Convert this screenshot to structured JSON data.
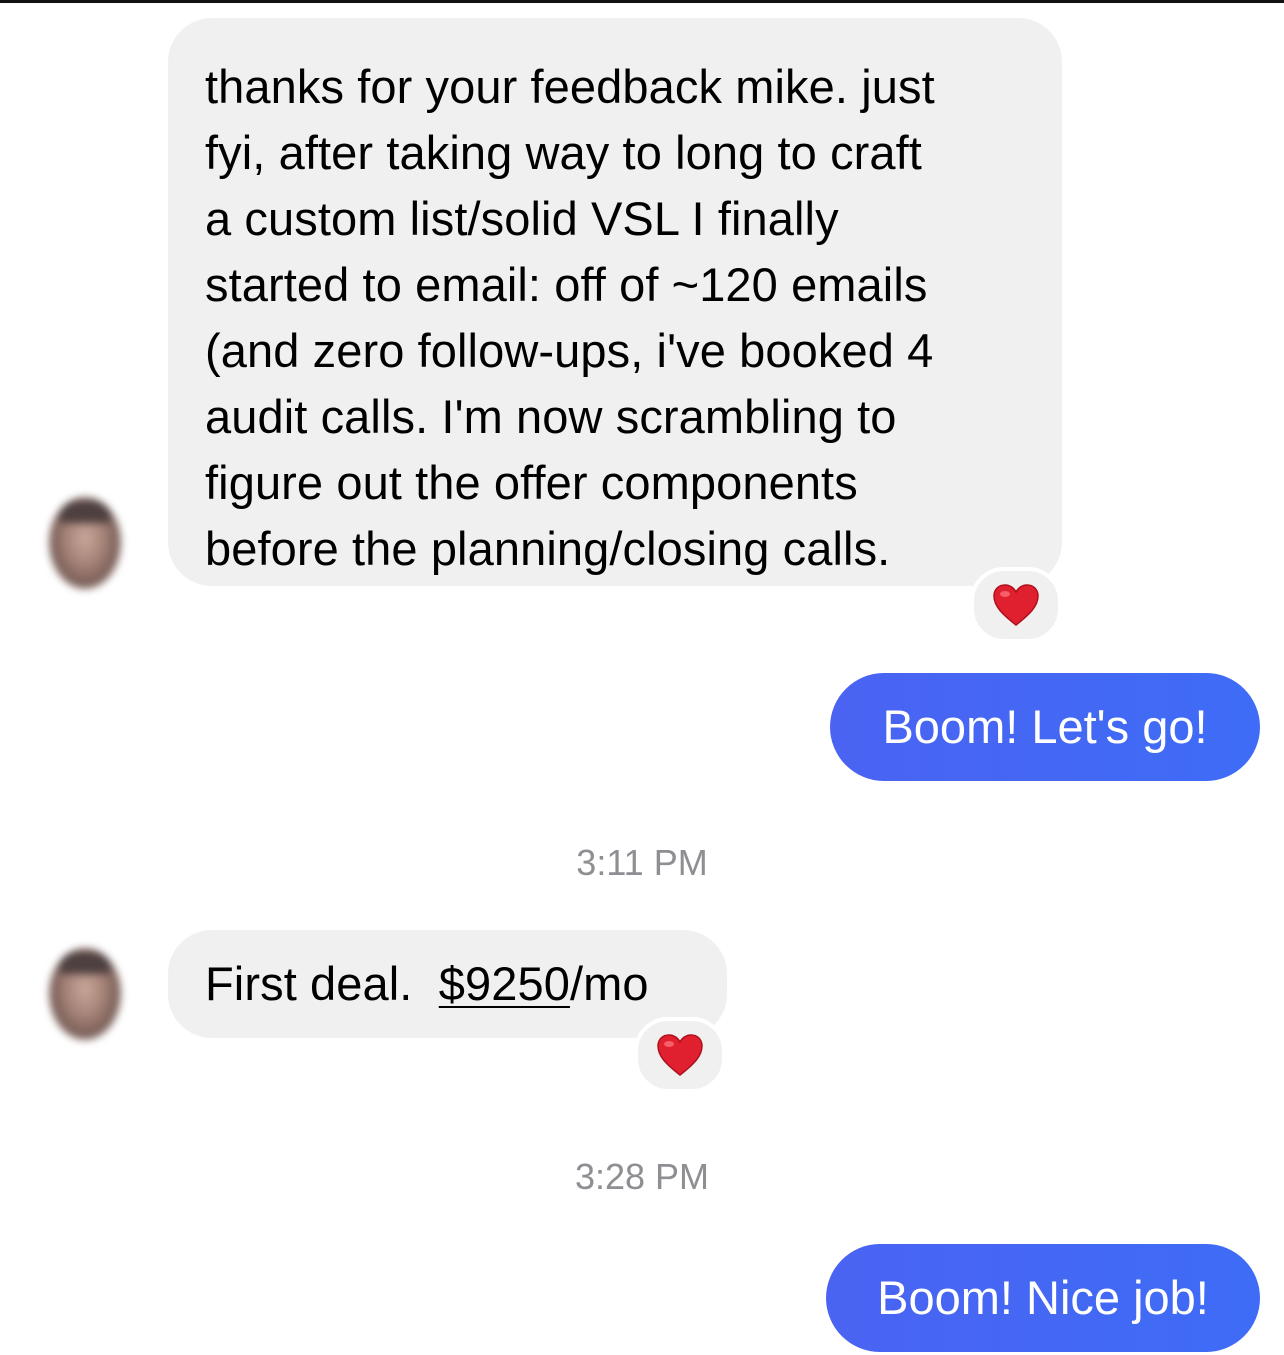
{
  "messages": [
    {
      "type": "incoming",
      "lines": [
        "thanks for your feedback mike.  just",
        "fyi, after taking way to long to craft",
        "a custom list/solid VSL I finally",
        "started to email: off of ~120 emails",
        "(and zero follow-ups, i've booked 4",
        "audit calls.  I'm now scrambling to",
        "figure out the offer components",
        "before the planning/closing calls."
      ],
      "reaction": "heart"
    },
    {
      "type": "outgoing",
      "text": "Boom! Let's go!"
    },
    {
      "type": "timestamp",
      "text": "3:11 PM"
    },
    {
      "type": "incoming",
      "text_prefix": "First deal.  ",
      "link_text": "$9250",
      "text_suffix": "/mo",
      "reaction": "heart"
    },
    {
      "type": "timestamp",
      "text": "3:28 PM"
    },
    {
      "type": "outgoing",
      "text": "Boom! Nice job!"
    }
  ],
  "colors": {
    "incoming_bubble": "#f0f0f0",
    "outgoing_bubble": "#4a6cf5",
    "timestamp": "#8e8e93",
    "heart": "#e0202e"
  }
}
